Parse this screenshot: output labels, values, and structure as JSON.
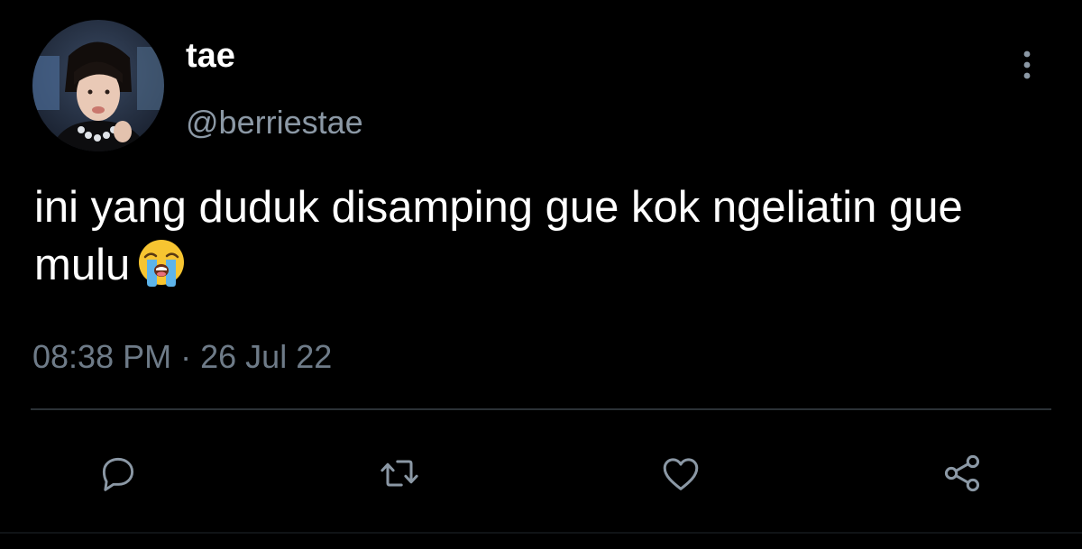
{
  "user": {
    "display_name": "tae",
    "handle": "@berriestae"
  },
  "tweet": {
    "text": "ini yang duduk disamping gue kok ngeliatin gue mulu",
    "emoji": "loudly-crying-face",
    "time": "08:38 PM",
    "separator": "·",
    "date": "26 Jul 22"
  },
  "actions": [
    {
      "icon": "reply-icon"
    },
    {
      "icon": "retweet-icon"
    },
    {
      "icon": "like-icon"
    },
    {
      "icon": "share-icon"
    }
  ],
  "colors": {
    "background": "#000000",
    "primary_text": "#ffffff",
    "secondary_text": "#8b98a5",
    "divider": "#2b3136",
    "icon": "#8b98a5"
  }
}
